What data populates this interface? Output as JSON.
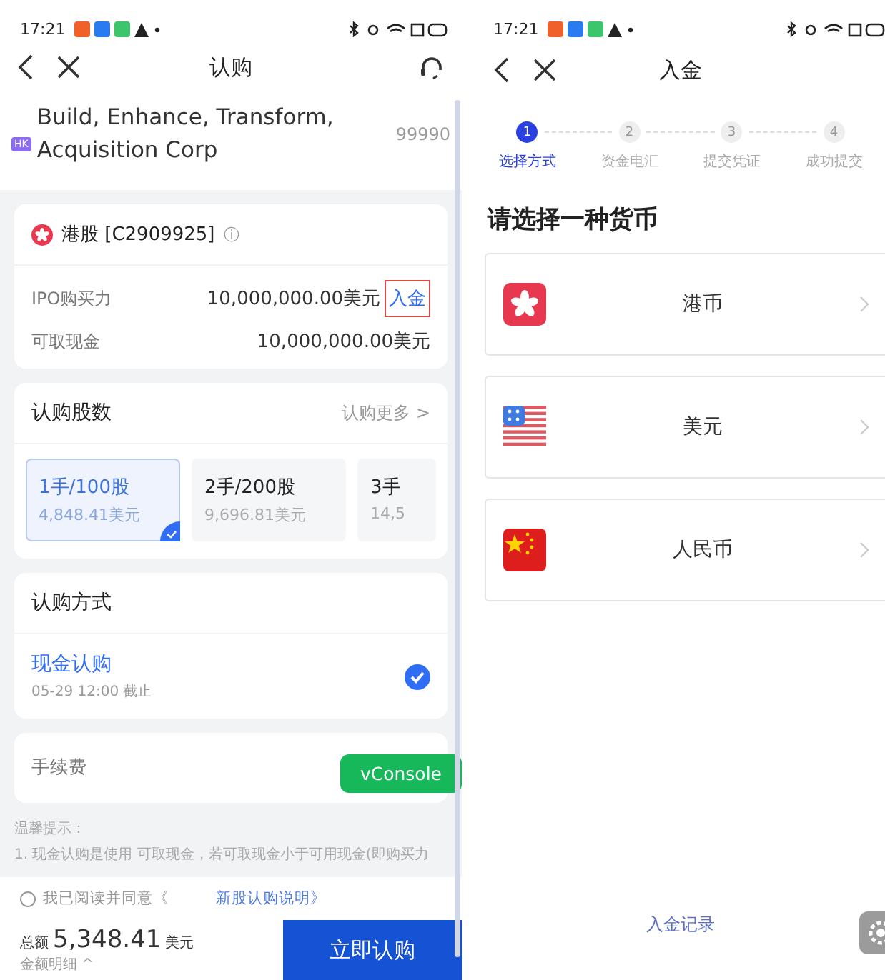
{
  "left_screen": {
    "status_bar": {
      "time": "17:21"
    },
    "nav": {
      "title": "认购"
    },
    "stock": {
      "market_badge": "HK",
      "name": "Build, Enhance, Transform, Acquisition Corp",
      "code": "99990"
    },
    "account": {
      "title": "港股 [C2909925]",
      "info": "ⓘ",
      "rows": [
        {
          "label": "IPO购买力",
          "value": "10,000,000.00美元",
          "link": "入金"
        },
        {
          "label": "可取现金",
          "value": "10,000,000.00美元"
        }
      ]
    },
    "shares": {
      "title": "认购股数",
      "more": "认购更多 >",
      "lots": [
        {
          "label": "1手/100股",
          "amount": "4,848.41美元",
          "selected": true
        },
        {
          "label": "2手/200股",
          "amount": "9,696.81美元",
          "selected": false
        },
        {
          "label": "3手",
          "amount": "14,5",
          "selected": false
        }
      ]
    },
    "method": {
      "title": "认购方式",
      "options": [
        {
          "name": "现金认购",
          "deadline": "05-29 12:00 截止",
          "selected": true
        }
      ]
    },
    "fee": {
      "label": "手续费"
    },
    "vconsole_button": "vConsole",
    "tips": {
      "title": "温馨提示：",
      "lines": [
        "1. 现金认购是使用 可取现金，若可取现金小于可用现金(即购买力"
      ]
    },
    "agreement": {
      "checked": false,
      "text": "我已阅读并同意《",
      "link": "新股认购说明》"
    },
    "footer": {
      "total_label": "总额",
      "total": "5,348.41",
      "currency": "美元",
      "details": "金额明细 ^",
      "button": "立即认购"
    }
  },
  "right_screen": {
    "status_bar": {
      "time": "17:21"
    },
    "nav": {
      "title": "入金"
    },
    "steps": [
      {
        "number": "1",
        "label": "选择方式",
        "selected": true
      },
      {
        "number": "2",
        "label": "资金电汇",
        "selected": false
      },
      {
        "number": "3",
        "label": "提交凭证",
        "selected": false
      },
      {
        "number": "4",
        "label": "成功提交",
        "selected": false
      }
    ],
    "heading": "请选择一种货币",
    "currencies": [
      {
        "kind": "hkd",
        "name": "港币"
      },
      {
        "kind": "usd",
        "name": "美元"
      },
      {
        "kind": "cny",
        "name": "人民币"
      }
    ],
    "records_link": "入金记录"
  }
}
